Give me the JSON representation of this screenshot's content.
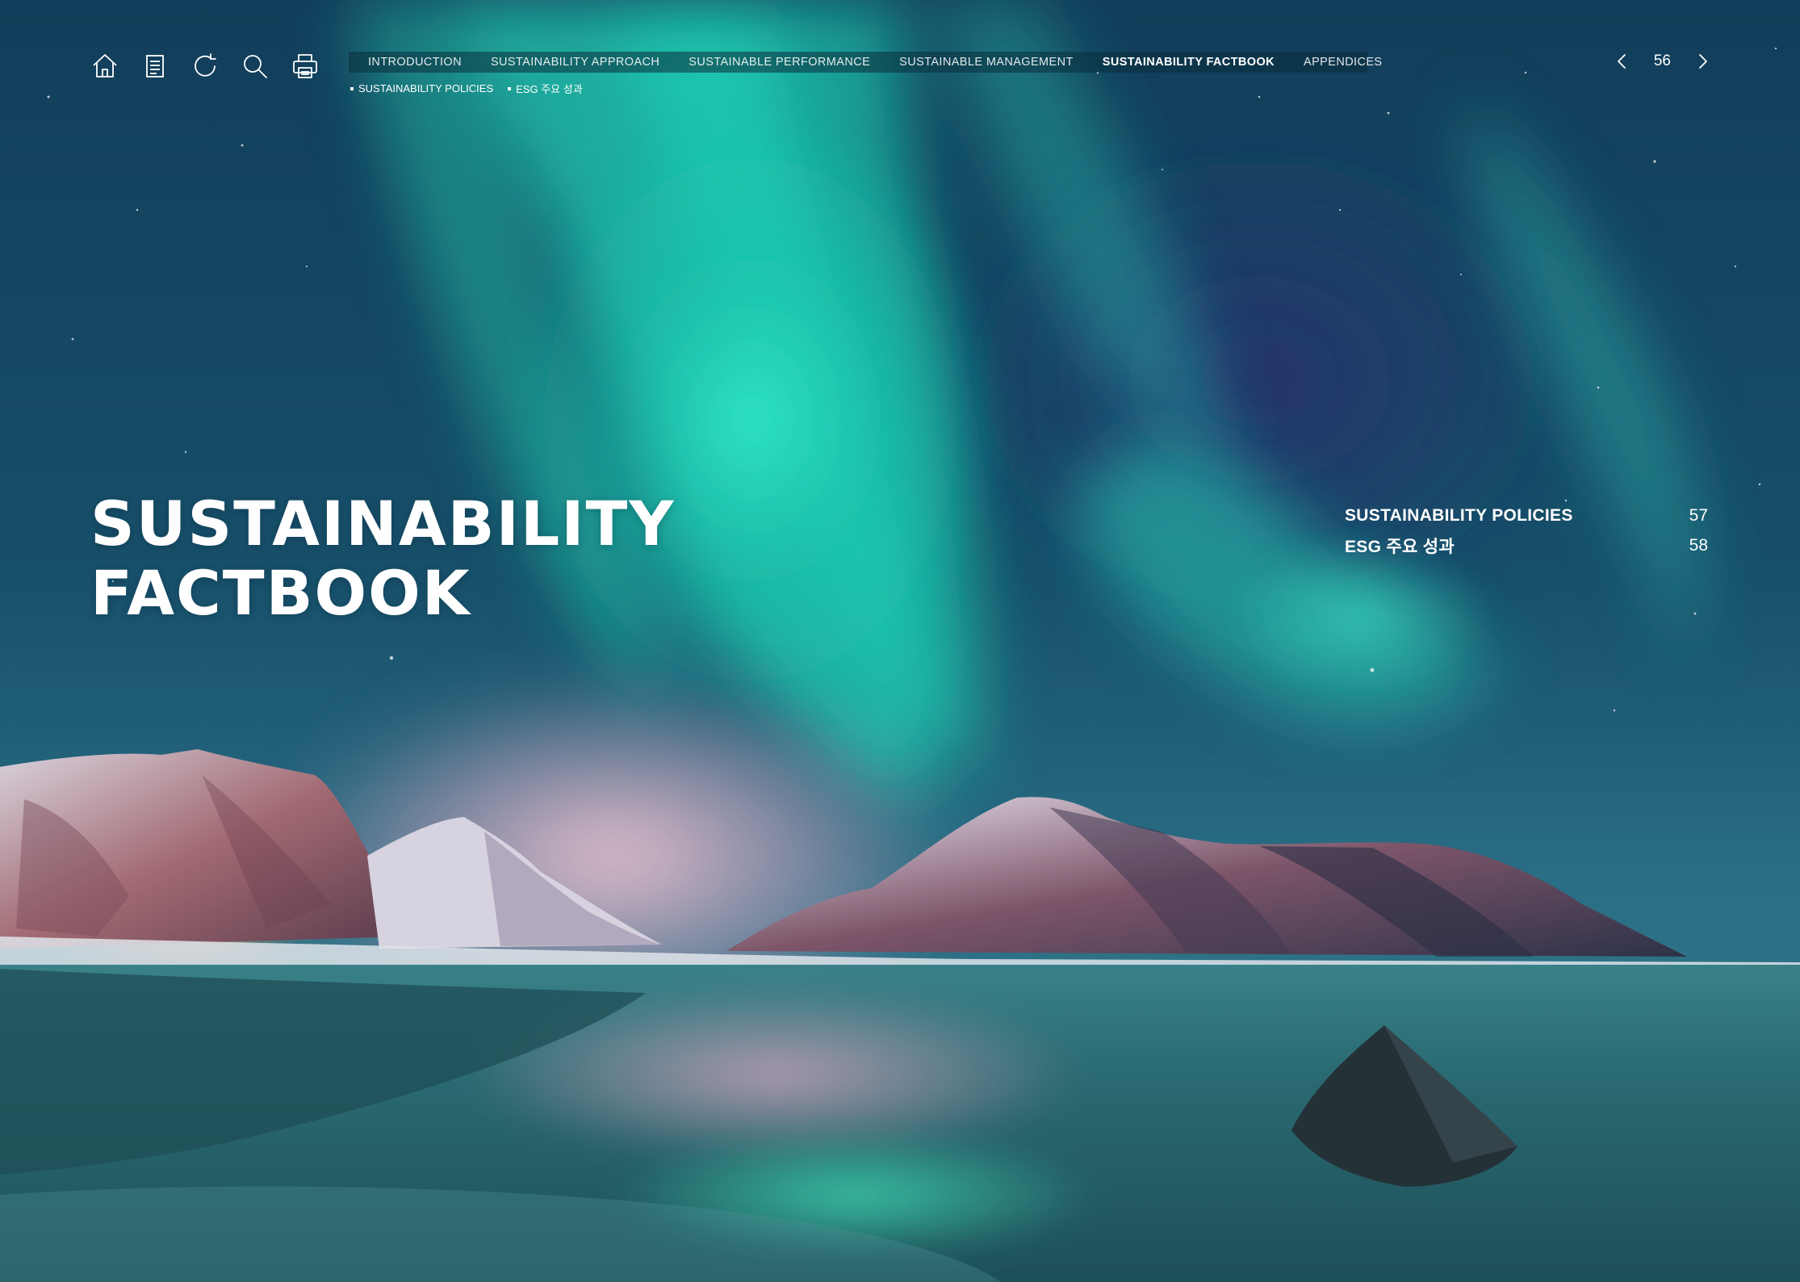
{
  "toolbar": {
    "icons": [
      "home-icon",
      "document-icon",
      "refresh-icon",
      "search-icon",
      "print-icon"
    ]
  },
  "nav": {
    "items": [
      {
        "label": "INTRODUCTION",
        "active": false
      },
      {
        "label": "SUSTAINABILITY APPROACH",
        "active": false
      },
      {
        "label": "SUSTAINABLE PERFORMANCE",
        "active": false
      },
      {
        "label": "SUSTAINABLE MANAGEMENT",
        "active": false
      },
      {
        "label": "SUSTAINABILITY FACTBOOK",
        "active": true
      },
      {
        "label": "APPENDICES",
        "active": false
      }
    ]
  },
  "subnav": {
    "items": [
      {
        "label": "SUSTAINABILITY POLICIES"
      },
      {
        "label": "ESG 주요 성과"
      }
    ]
  },
  "pager": {
    "page": "56",
    "prev_icon": "chevron-left-icon",
    "next_icon": "chevron-right-icon"
  },
  "title": {
    "line1": "SUSTAINABILITY",
    "line2": "FACTBOOK"
  },
  "toc": {
    "entries": [
      {
        "label": "SUSTAINABILITY POLICIES",
        "page": "57"
      },
      {
        "label": "ESG 주요 성과",
        "page": "58"
      }
    ]
  },
  "colors": {
    "sky_top": "#0f3a57",
    "aurora": "#22d8bf",
    "horizon_pink": "#e8b6c8",
    "water": "#2c6f78"
  }
}
